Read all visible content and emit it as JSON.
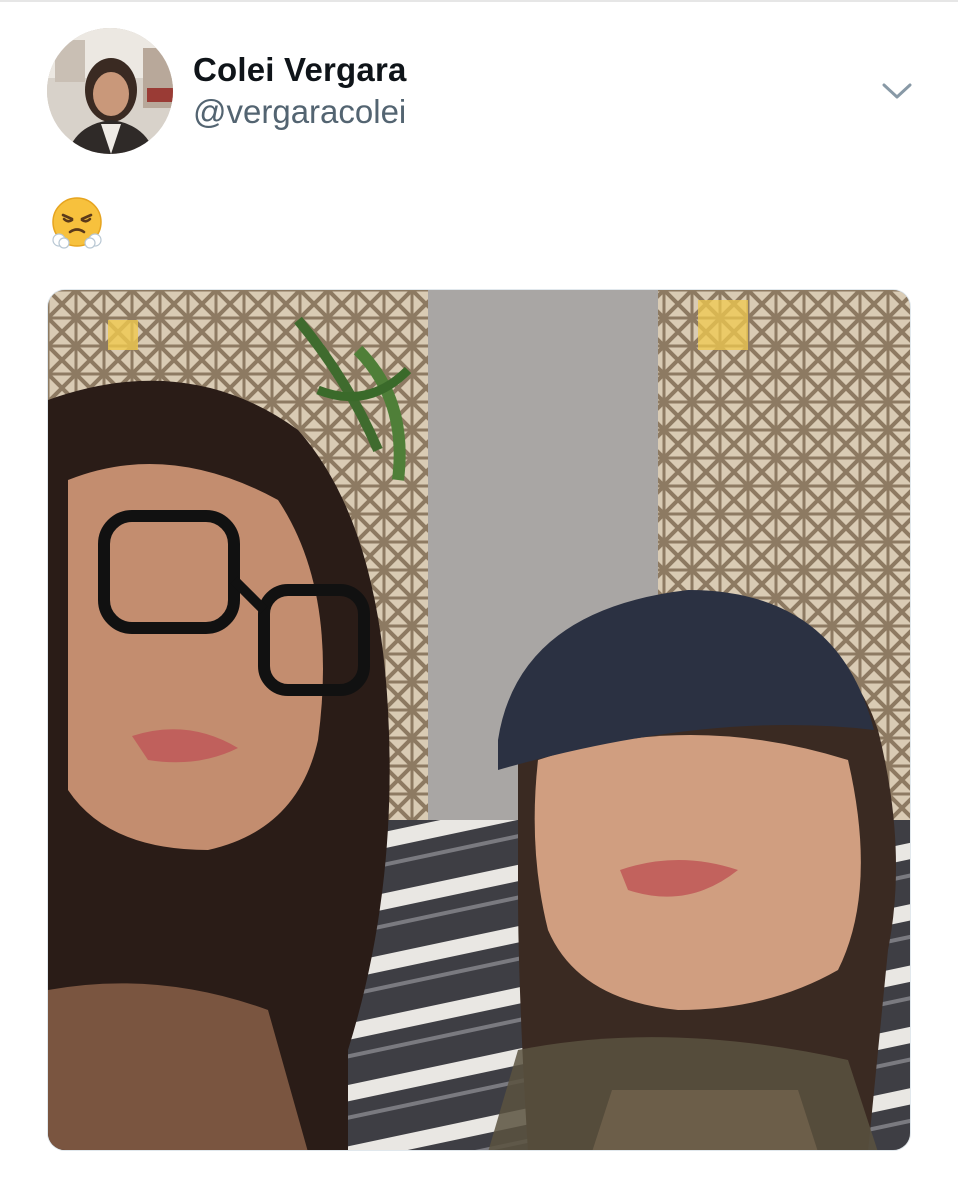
{
  "tweet": {
    "author": {
      "display_name": "Colei Vergara",
      "handle": "@vergaracolei"
    },
    "text_emoji": "face-with-steam-from-nose",
    "menu_icon": "chevron-down-icon",
    "media": {
      "kind": "photo",
      "depicts": "selfie of two women"
    }
  },
  "colors": {
    "display_name": "#0f1419",
    "handle": "#536471",
    "chevron": "#8899a6",
    "background": "#ffffff"
  }
}
